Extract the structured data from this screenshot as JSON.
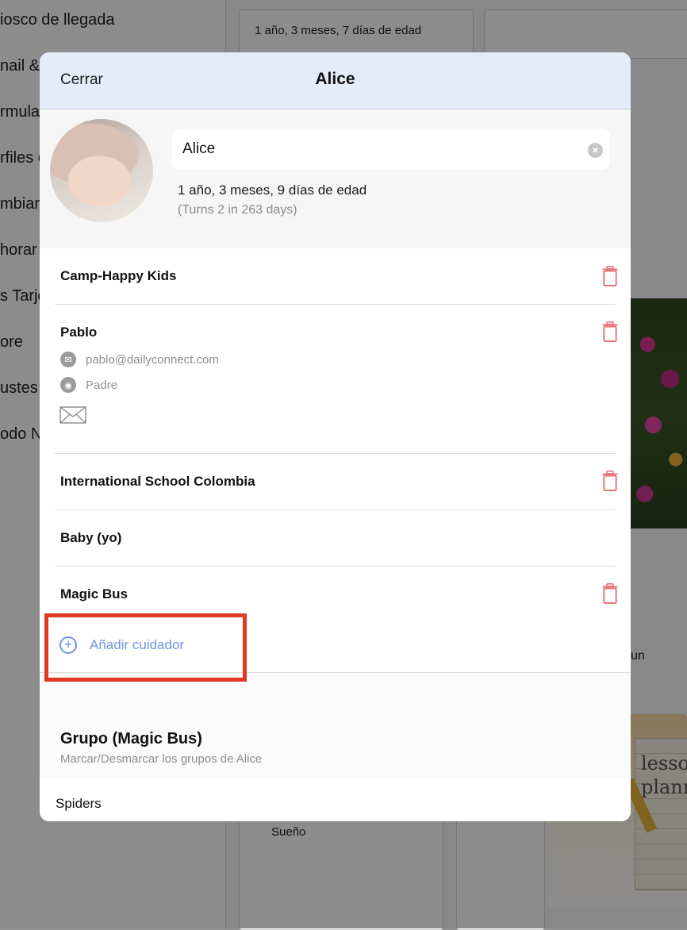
{
  "background": {
    "sidebar_items": [
      "iosco de llegada",
      "nail &",
      "rmula",
      "rfiles c",
      "mbiar",
      "horar",
      "s Tarje",
      "ore",
      "ustes",
      "odo N"
    ],
    "card_age_text": "1 año, 3 meses, 7 días de edad",
    "card_label_sueno": "Sueño",
    "partial_un": "un",
    "lesson_text_1": "lesso",
    "lesson_text_2": "plann"
  },
  "modal": {
    "close_label": "Cerrar",
    "title": "Alice",
    "child_name_value": "Alice",
    "age_text": "1 año, 3 meses, 9 días de edad",
    "turns_text": "(Turns 2 in 263 days)"
  },
  "caregivers": [
    {
      "name": "Camp-Happy Kids",
      "deletable": true
    },
    {
      "name": "Pablo",
      "email": "pablo@dailyconnect.com",
      "relation": "Padre",
      "deletable": true
    },
    {
      "name": "International School Colombia",
      "deletable": true
    },
    {
      "name": "Baby (yo)",
      "deletable": false
    },
    {
      "name": "Magic Bus",
      "deletable": true
    }
  ],
  "add_caregiver_label": "Añadir cuidador",
  "group": {
    "title": "Grupo (Magic Bus)",
    "subtitle": "Marcar/Desmarcar los grupos de Alice",
    "items": [
      "Spiders"
    ]
  },
  "colors": {
    "accent": "#6f96dc",
    "delete": "#e8767c",
    "highlight": "#e23a22",
    "header_bg": "#e4ebf9"
  }
}
